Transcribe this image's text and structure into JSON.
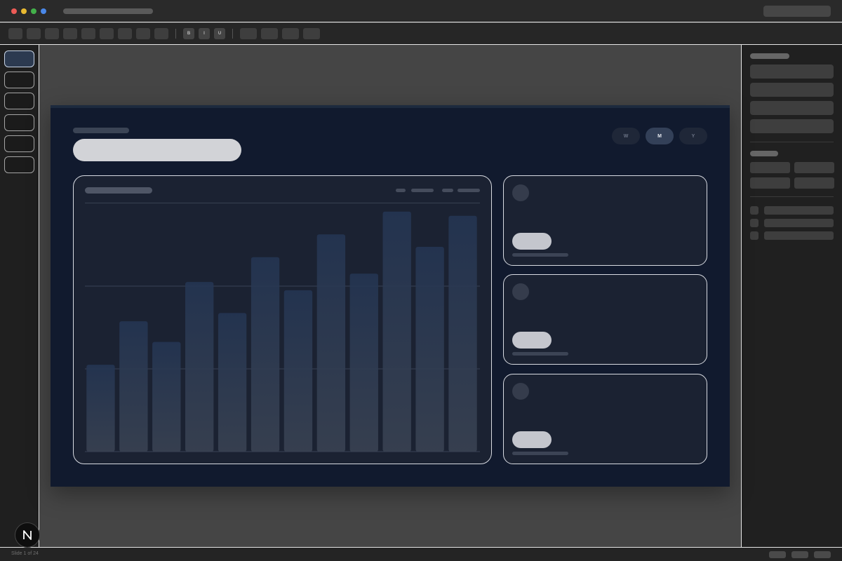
{
  "window": {
    "traffic_lights": [
      {
        "name": "close",
        "color": "#ec5b56"
      },
      {
        "name": "minimize",
        "color": "#e8b931"
      },
      {
        "name": "zoom",
        "color": "#43b04a"
      },
      {
        "name": "extra",
        "color": "#4a88e8"
      }
    ]
  },
  "toolbar": {
    "format_buttons": [
      {
        "label": "B",
        "icon": "bold-icon"
      },
      {
        "label": "I",
        "icon": "italic-icon"
      },
      {
        "label": "U",
        "icon": "underline-icon"
      }
    ]
  },
  "slides_panel": {
    "count": 6,
    "active_index": 0
  },
  "slide": {
    "range_pills": [
      {
        "label": "W",
        "active": false
      },
      {
        "label": "M",
        "active": true
      },
      {
        "label": "Y",
        "active": false
      }
    ],
    "stat_cards_count": 3,
    "colors": {
      "background": "#111a2e",
      "card": "#1b2232",
      "bar_top": "#2a3a55",
      "bar_bottom": "#3a4352"
    }
  },
  "chart_data": {
    "type": "bar",
    "categories": [
      "",
      "",
      "",
      "",
      "",
      "",
      "",
      "",
      "",
      "",
      "",
      ""
    ],
    "values": [
      42,
      63,
      53,
      82,
      67,
      94,
      78,
      105,
      86,
      116,
      99,
      114
    ],
    "ylim": [
      0,
      120
    ],
    "grid": true
  },
  "status_bar": {
    "slide_indicator": "Slide 1 of 24"
  },
  "badge": {
    "icon": "n-logo-icon"
  }
}
